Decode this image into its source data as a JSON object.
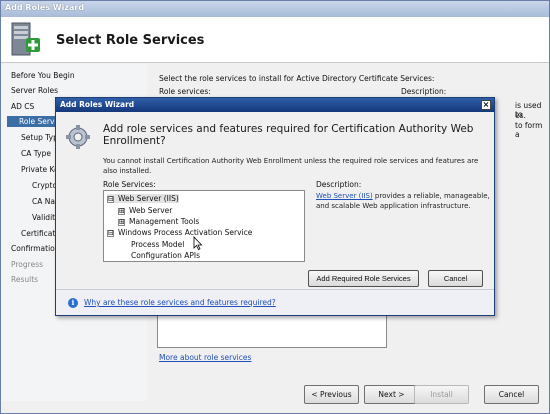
{
  "window": {
    "title": "Add Roles Wizard"
  },
  "header": {
    "title": "Select Role Services",
    "icon": "server-add-icon"
  },
  "nav": {
    "items": [
      {
        "label": "Before You Begin",
        "state": "normal"
      },
      {
        "label": "Server Roles",
        "state": "normal"
      },
      {
        "label": "AD CS",
        "state": "normal"
      },
      {
        "label": "Role Servi",
        "state": "selected"
      },
      {
        "label": "Setup Typ",
        "state": "normal"
      },
      {
        "label": "CA Type",
        "state": "normal"
      },
      {
        "label": "Private Ke",
        "state": "normal"
      },
      {
        "label": "Crypto",
        "state": "normal"
      },
      {
        "label": "CA Na",
        "state": "normal"
      },
      {
        "label": "Validity",
        "state": "normal"
      },
      {
        "label": "Certificat",
        "state": "normal"
      },
      {
        "label": "Confirmation",
        "state": "normal"
      },
      {
        "label": "Progress",
        "state": "disabled"
      },
      {
        "label": "Results",
        "state": "disabled"
      }
    ]
  },
  "main": {
    "intro": "Select the role services to install for Active Directory Certificate Services:",
    "role_services_label": "Role services:",
    "description_label": "Description:",
    "desc_fragments": [
      "is used to",
      "es.",
      "to form a"
    ],
    "more_link": "More about role services"
  },
  "footer": {
    "previous": "< Previous",
    "next": "Next >",
    "install": "Install",
    "cancel": "Cancel"
  },
  "dialog": {
    "title": "Add Roles Wizard",
    "close": "×",
    "heading": "Add role services and features required for Certification Authority Web Enrollment?",
    "info": "You cannot install Certification Authority Web Enrollment unless the required role services and features are also installed.",
    "role_services_label": "Role Services:",
    "description_label": "Description:",
    "tree": [
      {
        "label": "Web Server (IIS)",
        "toggle": "⊟",
        "highlight": true
      },
      {
        "label": "Web Server",
        "toggle": "⊞",
        "highlight": false
      },
      {
        "label": "Management Tools",
        "toggle": "⊞",
        "highlight": false
      },
      {
        "label": "Windows Process Activation Service",
        "toggle": "⊟",
        "highlight": false
      },
      {
        "label": "Process Model",
        "toggle": "",
        "highlight": false
      },
      {
        "label": "Configuration APIs",
        "toggle": "",
        "highlight": false
      }
    ],
    "description_link": "Web Server (IIS)",
    "description_text": " provides a reliable, manageable, and scalable Web application infrastructure.",
    "add_button": "Add Required Role Services",
    "cancel_button": "Cancel",
    "why_link": "Why are these role services and features required?"
  }
}
